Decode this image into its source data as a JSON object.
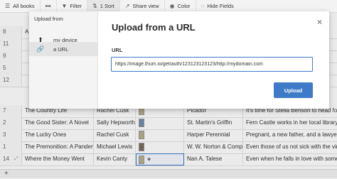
{
  "toolbar": {
    "all_books": "All books",
    "more": "•••",
    "filter": "Filter",
    "sort": "1 Sort",
    "share_view": "Share view",
    "color": "Color",
    "hide_fields": "Hide Fields"
  },
  "grid": {
    "rows": [
      {
        "num": "8",
        "title": "A",
        "author": "",
        "publisher": "",
        "description": "ld"
      },
      {
        "num": "11",
        "title": "",
        "author": "",
        "publisher": "",
        "description": "a"
      },
      {
        "num": "9",
        "title": "",
        "author": "",
        "publisher": "",
        "description": ""
      },
      {
        "num": "5",
        "title": "",
        "author": "",
        "publisher": "",
        "description": ""
      },
      {
        "num": "12",
        "title": "",
        "author": "",
        "publisher": "",
        "description": ""
      },
      {
        "num": "7",
        "title": "The Country Life",
        "author": "Rachel Cusk",
        "publisher": "Picador",
        "description": "It's time for Stella Benson to head for"
      },
      {
        "num": "2",
        "title": "The Good Sister: A Novel",
        "author": "Sally Hepworth",
        "publisher": "St. Martin's Griffin",
        "description": "Fern Castle works in her local library. S"
      },
      {
        "num": "3",
        "title": "The Lucky Ones",
        "author": "Rachel Cusk",
        "publisher": "Harper Perennial",
        "description": "Pregnant, a new father, and a lawyer"
      },
      {
        "num": "1",
        "title": "The Premonition: A Pandem...",
        "author": "Michael Lewis",
        "publisher": "W. W. Norton & Comp...",
        "description": "Even those of us not sick with the virus"
      },
      {
        "num": "14",
        "title": "Where the Money Went",
        "author": "Kevin Canty",
        "publisher": "Nan A. Talese",
        "description": "Even when he falls in love with someone"
      }
    ]
  },
  "bottom": {
    "add": "+"
  },
  "modal": {
    "side_title": "Upload from",
    "side_items": [
      {
        "label": "my device"
      },
      {
        "label": "a URL"
      }
    ],
    "title": "Upload from a URL",
    "close": "×",
    "url_label": "URL",
    "url_value": "https://image.thum.io/get/auth/123123123123/http://mydomain.com",
    "upload_button": "Upload"
  },
  "icons": {
    "device": "upload-icon",
    "url": "link-icon"
  },
  "colors": {
    "accent": "#3d7bc8",
    "toolbar_bg": "#f3f3f3",
    "side_bg": "#f4f4f4"
  }
}
